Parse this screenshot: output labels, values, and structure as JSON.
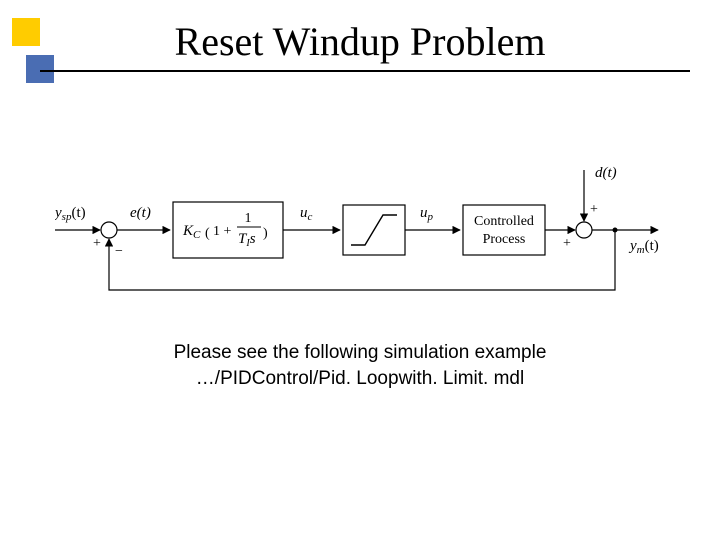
{
  "slide": {
    "title": "Reset Windup Problem",
    "caption_line1": "Please see the following simulation example",
    "caption_line2": "…/PIDControl/Pid. Loopwith. Limit. mdl"
  },
  "diagram": {
    "signals": {
      "setpoint": "y",
      "setpoint_sub": "sp",
      "setpoint_arg": "(t)",
      "error": "e(t)",
      "controller_out": "u",
      "controller_out_sub": "c",
      "limiter_out": "u",
      "limiter_out_sub": "p",
      "disturbance": "d(t)",
      "output": "y",
      "output_sub": "m",
      "output_arg": "(t)"
    },
    "blocks": {
      "controller_k": "K",
      "controller_k_sub": "C",
      "controller_paren_l": "(",
      "controller_one": "1 +",
      "controller_num": "1",
      "controller_den_T": "T",
      "controller_den_T_sub": "I",
      "controller_den_s": "s",
      "controller_paren_r": ")",
      "process_l1": "Controlled",
      "process_l2": "Process"
    },
    "sum_signs": {
      "sp_plus": "+",
      "fb_minus": "−",
      "dist_plus_top": "+",
      "dist_plus_left": "+"
    }
  }
}
